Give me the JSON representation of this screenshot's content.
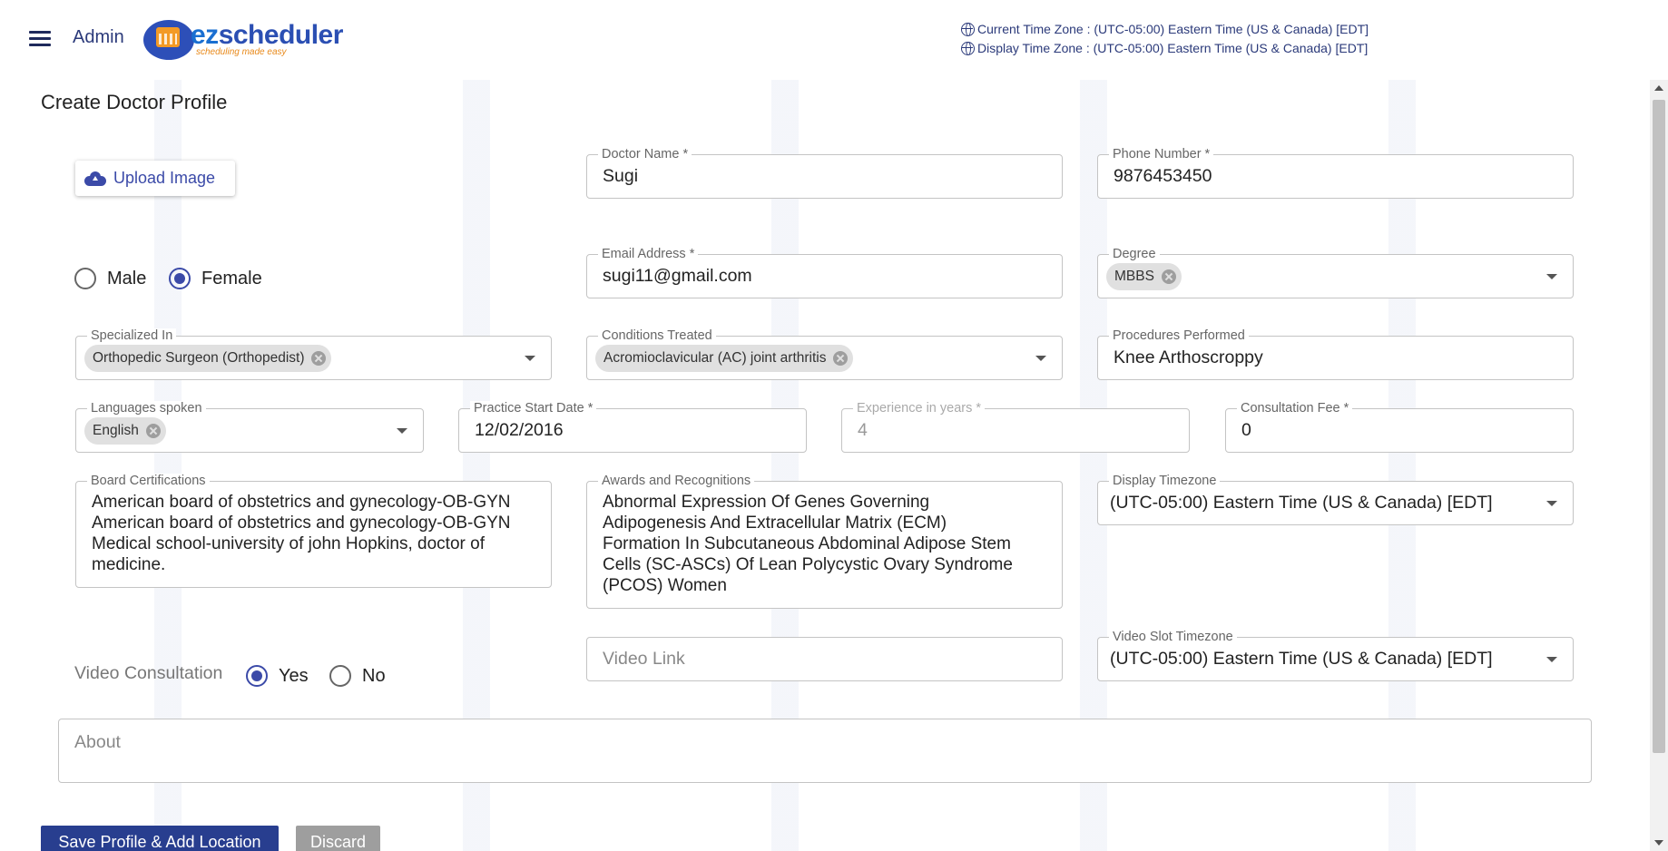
{
  "header": {
    "admin_label": "Admin",
    "logo_text_ez": "ez",
    "logo_text_rest": "scheduler",
    "logo_tagline": "scheduling made easy",
    "current_tz": "Current Time Zone : (UTC-05:00) Eastern Time (US & Canada) [EDT]",
    "display_tz": "Display Time Zone : (UTC-05:00) Eastern Time (US & Canada) [EDT]"
  },
  "page": {
    "title": "Create Doctor Profile"
  },
  "form": {
    "upload_label": "Upload Image",
    "gender": {
      "male": "Male",
      "female": "Female",
      "selected": "Female"
    },
    "doctor_name": {
      "label": "Doctor Name *",
      "value": "Sugi"
    },
    "phone": {
      "label": "Phone Number *",
      "value": "9876453450"
    },
    "email": {
      "label": "Email Address *",
      "value": "sugi11@gmail.com"
    },
    "degree": {
      "label": "Degree",
      "chips": [
        "MBBS"
      ]
    },
    "specialized": {
      "label": "Specialized In",
      "chips": [
        "Orthopedic Surgeon (Orthopedist)"
      ]
    },
    "conditions": {
      "label": "Conditions Treated",
      "chips": [
        "Acromioclavicular (AC) joint arthritis"
      ]
    },
    "procedures": {
      "label": "Procedures Performed",
      "value": "Knee Arthoscroppy"
    },
    "languages": {
      "label": "Languages spoken",
      "chips": [
        "English"
      ]
    },
    "practice_start": {
      "label": "Practice Start Date *",
      "value": "12/02/2016"
    },
    "experience": {
      "label": "Experience in years *",
      "value": "4"
    },
    "fee": {
      "label": "Consultation Fee  *",
      "value": "0"
    },
    "board_cert": {
      "label": "Board Certifications",
      "lines": [
        "American board of obstetrics and gynecology-OB-GYN",
        "American board of obstetrics and gynecology-OB-GYN",
        "Medical school-university of john Hopkins, doctor of",
        "medicine."
      ]
    },
    "awards": {
      "label": "Awards and Recognitions",
      "lines": [
        "Abnormal Expression Of Genes Governing",
        "Adipogenesis And Extracellular Matrix (ECM)",
        "Formation In Subcutaneous Abdominal Adipose Stem",
        "Cells (SC-ASCs) Of Lean Polycystic Ovary Syndrome",
        "(PCOS) Women"
      ]
    },
    "display_timezone": {
      "label": "Display Timezone",
      "value": "(UTC-05:00) Eastern Time (US & Canada) [EDT]"
    },
    "video_consultation": {
      "label": "Video Consultation",
      "yes": "Yes",
      "no": "No",
      "selected": "Yes"
    },
    "video_link": {
      "placeholder": "Video Link"
    },
    "video_slot_tz": {
      "label": "Video Slot Timezone",
      "value": "(UTC-05:00) Eastern Time (US & Canada) [EDT]"
    },
    "about": {
      "placeholder": "About"
    }
  },
  "actions": {
    "save": "Save Profile & Add Location",
    "discard": "Discard"
  },
  "colors": {
    "primary": "#283e8f",
    "accent": "#3b4aa8",
    "discard": "#9e9e9e"
  }
}
